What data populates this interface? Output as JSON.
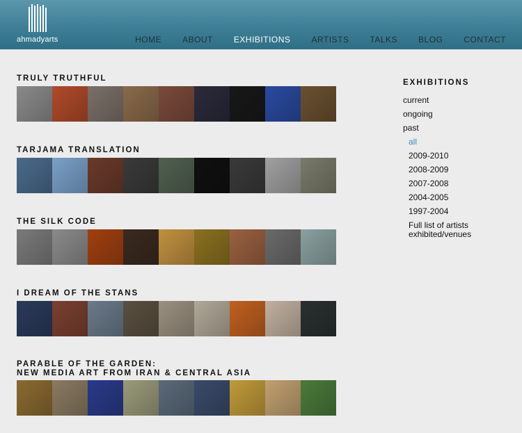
{
  "header": {
    "logo_text": "ahmadyarts",
    "nav": [
      {
        "label": "HOME"
      },
      {
        "label": "ABOUT"
      },
      {
        "label": "EXHIBITIONS"
      },
      {
        "label": "ARTISTS"
      },
      {
        "label": "TALKS"
      },
      {
        "label": "BLOG"
      },
      {
        "label": "CONTACT"
      }
    ]
  },
  "sections": [
    {
      "title": "TRULY TRUTHFUL",
      "thumbs": [
        "#8a8a8a",
        "#b04a2a",
        "#7a7068",
        "#8a6a4a",
        "#7a4a3a",
        "#2a2a3a",
        "#181818",
        "#2a4aa0",
        "#6a5030"
      ]
    },
    {
      "title": "TARJAMA TRANSLATION",
      "thumbs": [
        "#4a6a8a",
        "#7aa0c8",
        "#6a3a2a",
        "#3a3a3a",
        "#506050",
        "#101010",
        "#3a3a3a",
        "#a0a0a0",
        "#7a7a6a"
      ]
    },
    {
      "title": "THE SILK CODE",
      "thumbs": [
        "#7a7a7a",
        "#8a8a8a",
        "#a04010",
        "#3a2a20",
        "#c09040",
        "#8a7020",
        "#9a6040",
        "#6a6a6a",
        "#8aa0a0"
      ]
    },
    {
      "title": "I DREAM OF THE STANS",
      "thumbs": [
        "#2a3a5a",
        "#7a4030",
        "#6a7a8a",
        "#5a5040",
        "#9a9080",
        "#b0a898",
        "#c06020",
        "#c0b0a0",
        "#2a3030"
      ]
    },
    {
      "title": "PARABLE OF THE GARDEN:",
      "title2": "NEW MEDIA ART FROM IRAN & CENTRAL ASIA",
      "thumbs": [
        "#8a6a30",
        "#8a7a60",
        "#2a3a8a",
        "#9a9a7a",
        "#5a6a7a",
        "#3a4a6a",
        "#c09a3a",
        "#c0a070",
        "#4a7a3a"
      ]
    }
  ],
  "sidebar": {
    "title": "EXHIBITIONS",
    "items": [
      {
        "label": "current"
      },
      {
        "label": "ongoing"
      },
      {
        "label": "past"
      }
    ],
    "sub": [
      {
        "label": "all",
        "active": true
      },
      {
        "label": "2009-2010"
      },
      {
        "label": "2008-2009"
      },
      {
        "label": "2007-2008"
      },
      {
        "label": "2004-2005"
      },
      {
        "label": "1997-2004"
      },
      {
        "label": "Full list of artists exhibited/venues"
      }
    ]
  }
}
